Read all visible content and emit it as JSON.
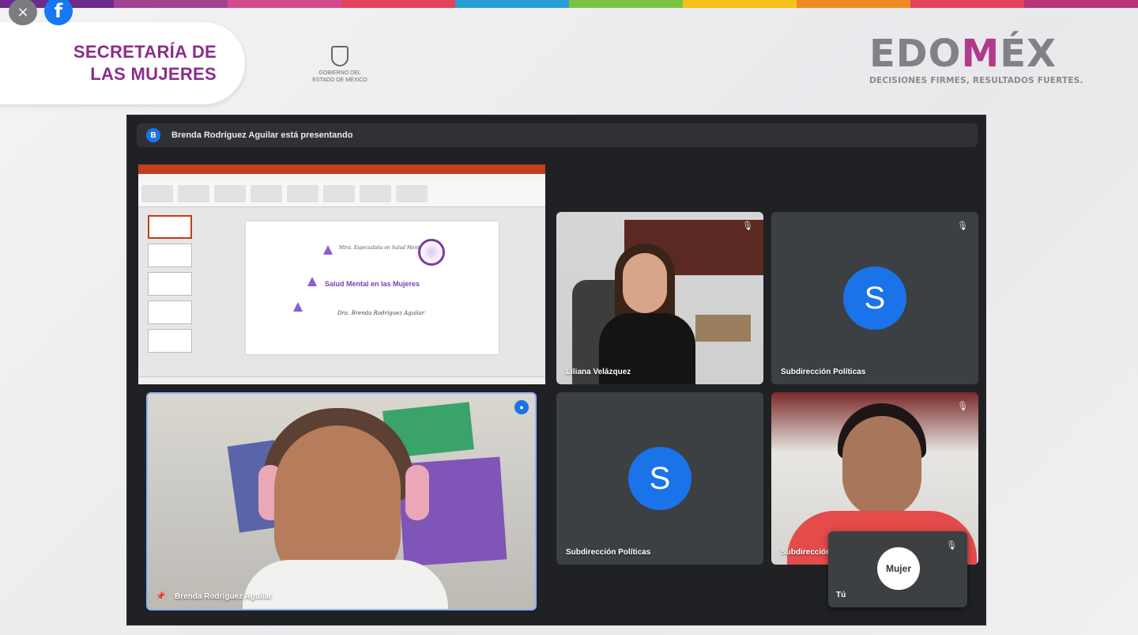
{
  "stripe_colors": [
    "#6b2a8c",
    "#a0428f",
    "#d14a8b",
    "#e2445c",
    "#2a9fd6",
    "#7cc242",
    "#f6c21a",
    "#f08a24",
    "#e2445c",
    "#b7327a"
  ],
  "overlay": {
    "close_icon": "×",
    "facebook_icon": "f"
  },
  "header": {
    "secretaria_line1": "SECRETARÍA DE",
    "secretaria_line2": "LAS MUJERES",
    "gob_line1": "GOBIERNO DEL",
    "gob_line2": "ESTADO DE MÉXICO",
    "edomex_logo_a": "EDO",
    "edomex_logo_b": "M",
    "edomex_logo_c": "ÉX",
    "edomex_tagline": "DECISIONES FIRMES, RESULTADOS FUERTES."
  },
  "meet": {
    "presenter_avatar": "B",
    "presenting_text": "Brenda Rodríguez Aguilar está presentando",
    "slide": {
      "subtitle": "Mtra. Especialista en Salud Mental",
      "title": "Salud Mental en las Mujeres",
      "signature": "Dra. Brenda Rodríguez Aguilar"
    },
    "tiles": {
      "liliana_name": "Liliana Velázquez",
      "subdireccion_1_avatar": "S",
      "subdireccion_1_name": "Subdirección Políticas",
      "brenda_name": "Brenda Rodríguez Aguilar",
      "subdireccion_2_avatar": "S",
      "subdireccion_2_name": "Subdirección Políticas",
      "mujer_name": "Subdirección",
      "self_logo": "Mujer",
      "self_name": "Tú"
    },
    "icons": {
      "mic_off": "🎙",
      "speaking": "●",
      "pin": "📌"
    }
  }
}
